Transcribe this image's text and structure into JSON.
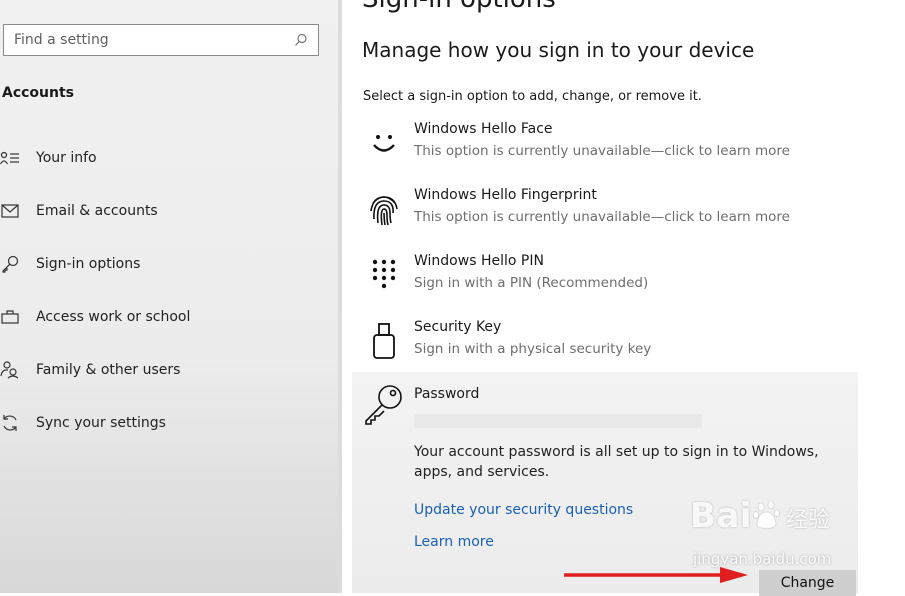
{
  "search": {
    "placeholder": "Find a setting",
    "icon": "search-icon"
  },
  "sidebar": {
    "section": "Accounts",
    "items": [
      {
        "label": "Your info",
        "icon": "person-info-icon"
      },
      {
        "label": "Email & accounts",
        "icon": "mail-icon"
      },
      {
        "label": "Sign-in options",
        "icon": "key-icon"
      },
      {
        "label": "Access work or school",
        "icon": "briefcase-icon"
      },
      {
        "label": "Family & other users",
        "icon": "family-icon"
      },
      {
        "label": "Sync your settings",
        "icon": "sync-icon"
      }
    ]
  },
  "main": {
    "title": "Sign-in options",
    "heading": "Manage how you sign in to your device",
    "subtitle": "Select a sign-in option to add, change, or remove it.",
    "options": [
      {
        "title": "Windows Hello Face",
        "desc": "This option is currently unavailable—click to learn more",
        "icon": "face-icon"
      },
      {
        "title": "Windows Hello Fingerprint",
        "desc": "This option is currently unavailable—click to learn more",
        "icon": "fingerprint-icon"
      },
      {
        "title": "Windows Hello PIN",
        "desc": "Sign in with a PIN (Recommended)",
        "icon": "pin-keypad-icon"
      },
      {
        "title": "Security Key",
        "desc": "Sign in with a physical security key",
        "icon": "usb-key-icon"
      }
    ],
    "password": {
      "title": "Password",
      "desc": "Your account password is all set up to sign in to Windows, apps, and services.",
      "link_questions": "Update your security questions",
      "link_learn": "Learn more",
      "change_label": "Change",
      "icon": "key-icon"
    }
  },
  "watermark": {
    "brand": "Bai",
    "brand2": "经验",
    "url": "jingyan.baidu.com"
  },
  "colors": {
    "link": "#1a5fb4",
    "arrow": "#e01e1e"
  }
}
